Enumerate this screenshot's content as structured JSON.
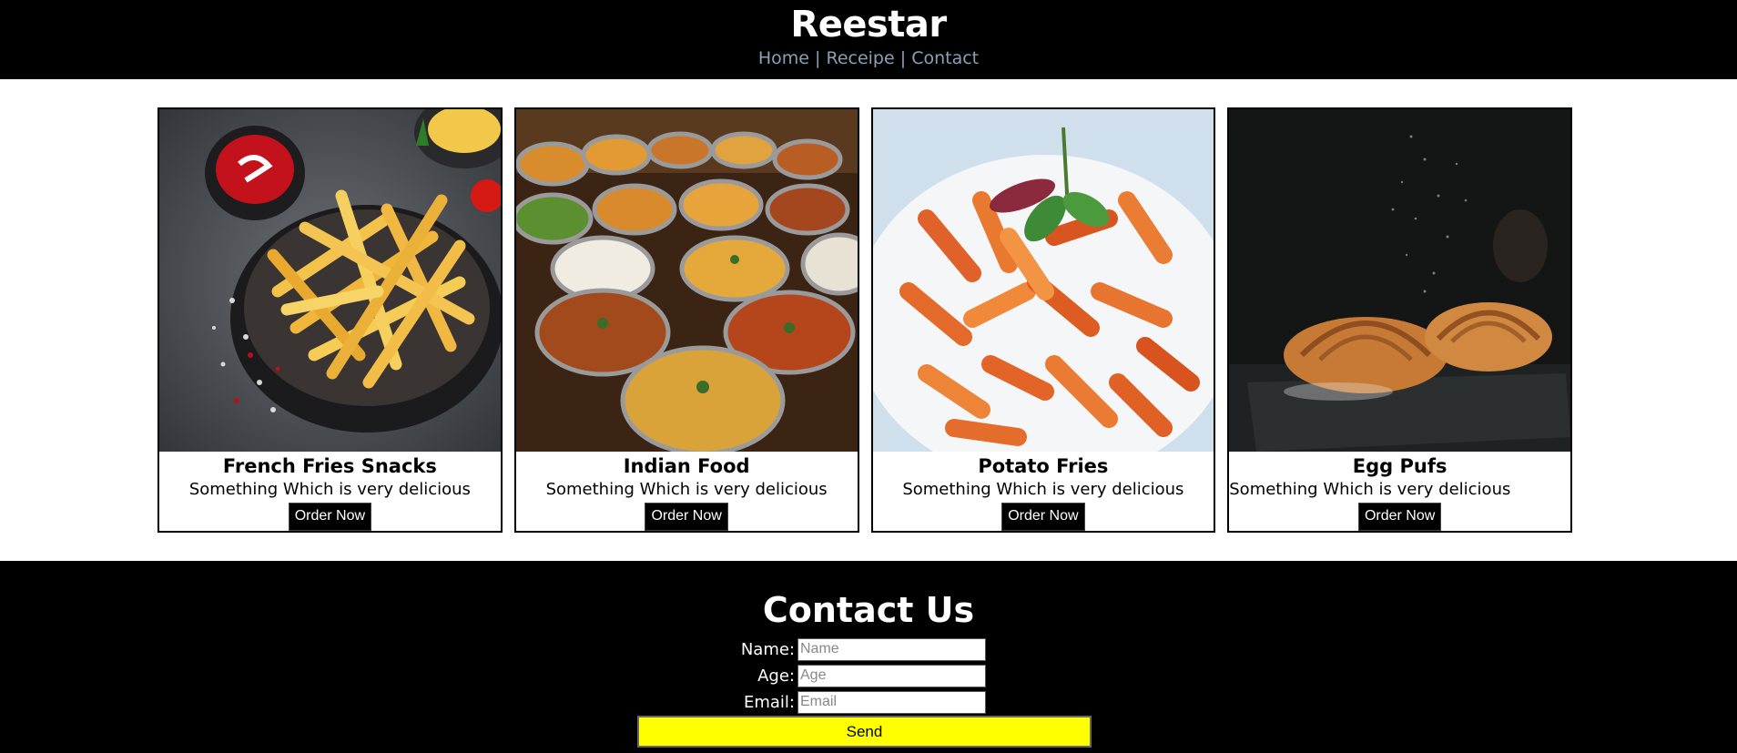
{
  "header": {
    "brand": "Reestar",
    "nav": [
      {
        "label": "Home"
      },
      {
        "label": "Receipe"
      },
      {
        "label": "Contact"
      }
    ],
    "separator": "|"
  },
  "cards": [
    {
      "title": "French Fries Snacks",
      "description": "Something Which is very delicious",
      "button": "Order Now",
      "image": "french fries in a bowl with ketchup"
    },
    {
      "title": "Indian Food",
      "description": "Something Which is very delicious",
      "button": "Order Now",
      "image": "bowls of indian curries and rice"
    },
    {
      "title": "Potato Fries",
      "description": "Something Which is very delicious",
      "button": "Order Now",
      "image": "plate of penne pasta with basil"
    },
    {
      "title": "Egg Pufs",
      "description": "Something Which is very delicious",
      "button": "Order Now",
      "image": "croissants dusted with flour on dark slate"
    }
  ],
  "contact": {
    "title": "Contact Us",
    "fields": [
      {
        "label": "Name:",
        "placeholder": "Name"
      },
      {
        "label": "Age:",
        "placeholder": "Age"
      },
      {
        "label": "Email:",
        "placeholder": "Email"
      }
    ],
    "submit": "Send"
  },
  "colors": {
    "header_bg": "#000000",
    "nav_link": "#8aa0b8",
    "send_button": "#ffff00"
  }
}
